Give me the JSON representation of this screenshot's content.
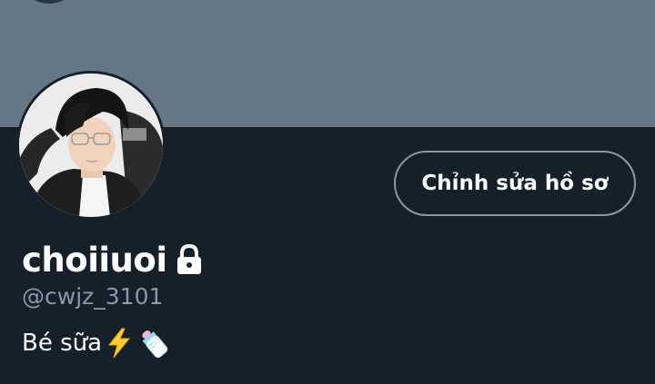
{
  "profile": {
    "display_name": "choiiuoi",
    "handle": "@cwjz_3101",
    "bio_text": "Bé sữa",
    "bio_emojis": [
      "high-voltage-emoji",
      "baby-bottle-emoji"
    ],
    "protected": true,
    "lock_icon": "lock-icon"
  },
  "actions": {
    "edit_profile_label": "Chỉnh sửa hồ sơ"
  },
  "colors": {
    "background": "#15202b",
    "banner": "#657786",
    "secondary_text": "#8899a6",
    "primary_text": "#ffffff",
    "button_border": "#8899a6"
  }
}
